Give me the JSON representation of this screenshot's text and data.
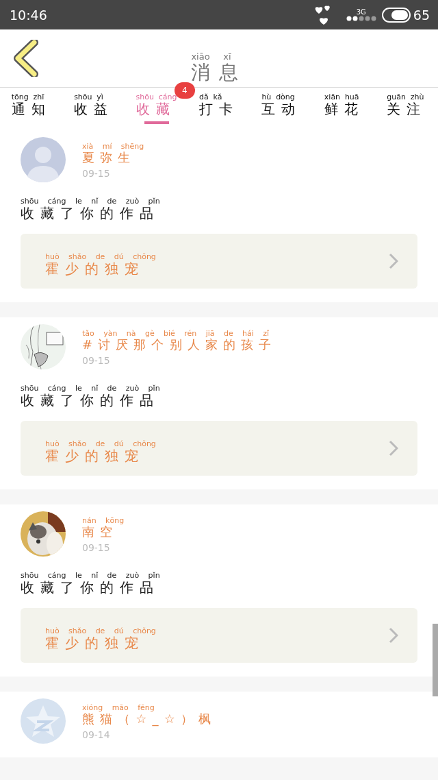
{
  "status_bar": {
    "time": "10:46",
    "network": "3G",
    "battery": "65"
  },
  "header": {
    "title": {
      "text": "消息",
      "pinyin": "xiāo xī"
    }
  },
  "tabs": [
    {
      "label": {
        "text": "通知",
        "pinyin": "tōng zhī"
      },
      "selected": false
    },
    {
      "label": {
        "text": "收益",
        "pinyin": "shōu yì"
      },
      "selected": false
    },
    {
      "label": {
        "text": "收藏",
        "pinyin": "shōu cáng"
      },
      "selected": true,
      "badge": "4"
    },
    {
      "label": {
        "text": "打卡",
        "pinyin": "dǎ kǎ"
      },
      "selected": false
    },
    {
      "label": {
        "text": "互动",
        "pinyin": "hù dòng"
      },
      "selected": false
    },
    {
      "label": {
        "text": "鲜花",
        "pinyin": "xiān huā"
      },
      "selected": false
    },
    {
      "label": {
        "text": "关注",
        "pinyin": "guān zhù"
      },
      "selected": false
    }
  ],
  "messages": [
    {
      "avatar": {
        "kind": "default"
      },
      "name": {
        "text": "夏弥生",
        "pinyin": "xià mí shēng"
      },
      "date": "09-15",
      "message": {
        "text": "收藏了你的作品",
        "pinyin": "shōu cáng le nǐ de zuò pǐn"
      },
      "work": {
        "text": "霍少的独宠",
        "pinyin": "huò shǎo de dú chǒng"
      }
    },
    {
      "avatar": {
        "kind": "sketch"
      },
      "name": {
        "text": "#讨厌那个别人家的孩子",
        "pinyin": "tǎo yàn nà gè bié rén jiā de hái zǐ"
      },
      "date": "09-15",
      "message": {
        "text": "收藏了你的作品",
        "pinyin": "shōu cáng le nǐ de zuò pǐn"
      },
      "work": {
        "text": "霍少的独宠",
        "pinyin": "huò shǎo de dú chǒng"
      }
    },
    {
      "avatar": {
        "kind": "cat"
      },
      "name": {
        "text": "南空",
        "pinyin": "nán kōng"
      },
      "date": "09-15",
      "message": {
        "text": "收藏了你的作品",
        "pinyin": "shōu cáng le nǐ de zuò pǐn"
      },
      "work": {
        "text": "霍少的独宠",
        "pinyin": "huò shǎo de dú chǒng"
      }
    },
    {
      "avatar": {
        "kind": "star"
      },
      "name": {
        "text": "熊猫（☆_☆）枫",
        "pinyin": "xióng māo fēng"
      },
      "date": "09-14"
    }
  ]
}
